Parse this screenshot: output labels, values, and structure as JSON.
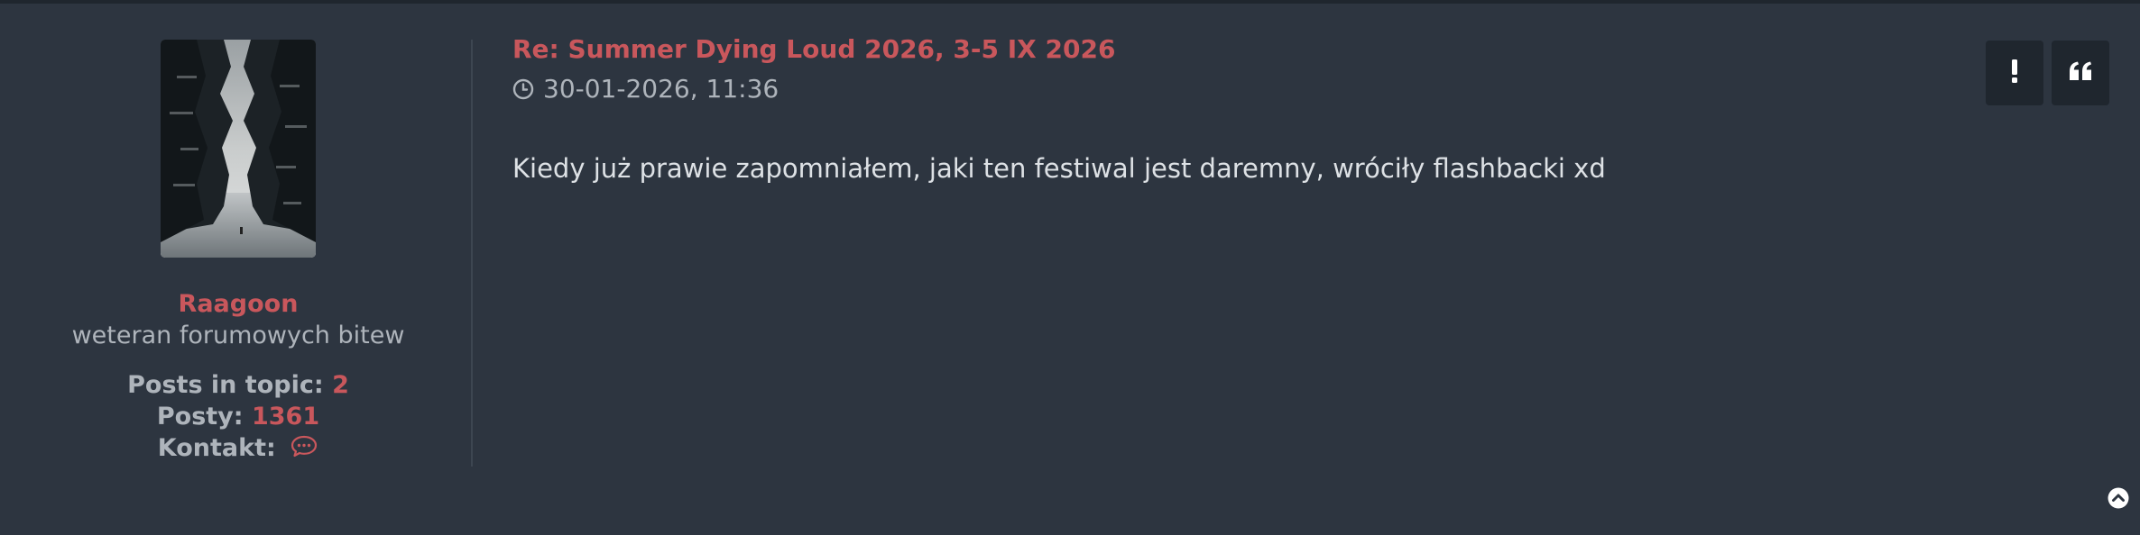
{
  "post": {
    "title": "Re: Summer Dying Loud 2026, 3-5 IX 2026",
    "timestamp": "30-01-2026, 11:36",
    "content": "Kiedy już prawie zapomniałem, jaki ten festiwal jest daremny, wróciły flashbacki xd"
  },
  "author": {
    "username": "Raagoon",
    "rank": "weteran forumowych bitew",
    "posts_in_topic_label": "Posts in topic:",
    "posts_in_topic_value": "2",
    "posts_label": "Posty:",
    "posts_value": "1361",
    "contact_label": "Kontakt:"
  },
  "actions": {
    "report_icon": "exclamation-icon",
    "quote_icon": "quote-icon",
    "back_to_top_icon": "chevron-up-circle-icon"
  },
  "colors": {
    "background": "#2d3540",
    "accent": "#c9575c",
    "muted_text": "#aeb4bb",
    "body_text": "#dde1e5",
    "button_bg": "#1f262e"
  }
}
